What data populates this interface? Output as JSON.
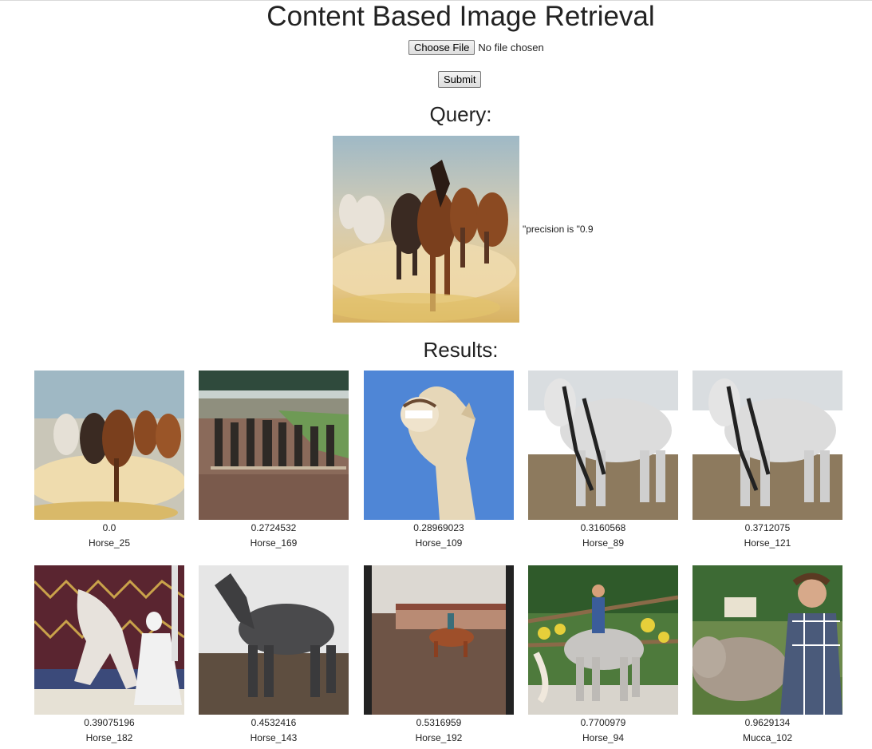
{
  "title": "Content Based Image Retrieval",
  "upload": {
    "choose_label": "Choose File",
    "status": "No file chosen",
    "submit_label": "Submit"
  },
  "query": {
    "heading": "Query:",
    "precision_text": "\"precision is \"0.9"
  },
  "results": {
    "heading": "Results:",
    "items": [
      {
        "score": "0.0",
        "name": "Horse_25"
      },
      {
        "score": "0.2724532",
        "name": "Horse_169"
      },
      {
        "score": "0.28969023",
        "name": "Horse_109"
      },
      {
        "score": "0.3160568",
        "name": "Horse_89"
      },
      {
        "score": "0.3712075",
        "name": "Horse_121"
      },
      {
        "score": "0.39075196",
        "name": "Horse_182"
      },
      {
        "score": "0.4532416",
        "name": "Horse_143"
      },
      {
        "score": "0.5316959",
        "name": "Horse_192"
      },
      {
        "score": "0.7700979",
        "name": "Horse_94"
      },
      {
        "score": "0.9629134",
        "name": "Mucca_102"
      }
    ]
  }
}
